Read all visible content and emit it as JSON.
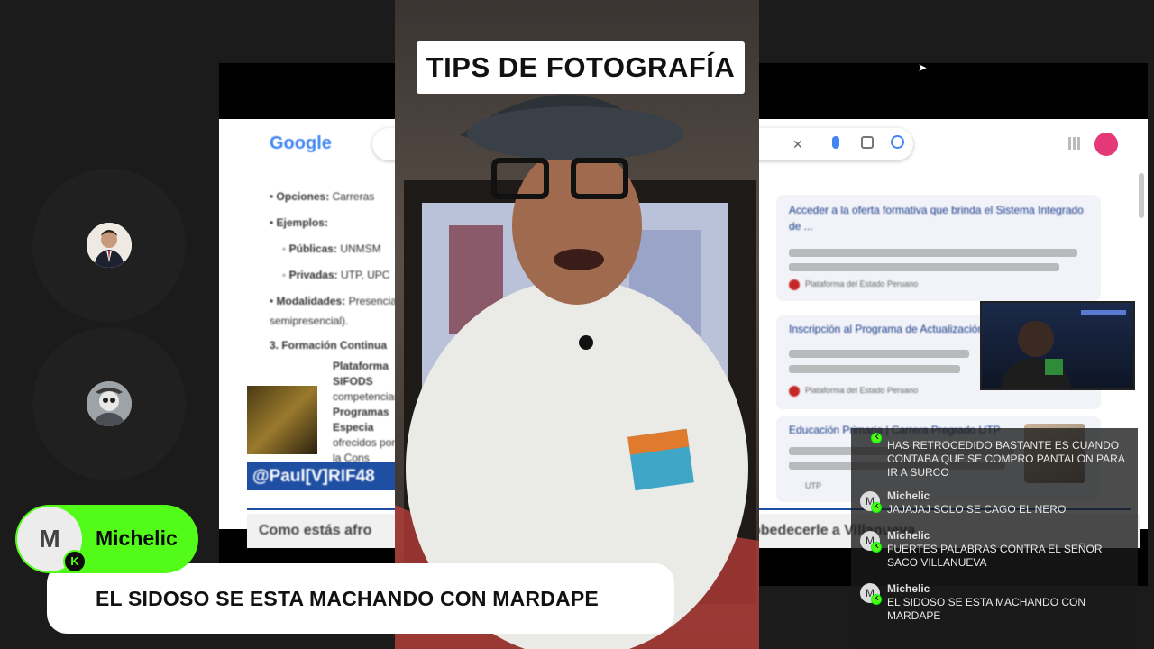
{
  "video": {
    "caption": "TIPS DE FOTOGRAFÍA"
  },
  "screen": {
    "google_logo": "Google",
    "list": [
      {
        "bullet": "•",
        "label": "Opciones:",
        "text": "Carreras"
      },
      {
        "bullet": "•",
        "label": "Ejemplos:",
        "text": ""
      },
      {
        "bullet": "◦",
        "label": "Públicas:",
        "text": "UNMSM"
      },
      {
        "bullet": "◦",
        "label": "Privadas:",
        "text": "UTP, UPC"
      },
      {
        "bullet": "•",
        "label": "Modalidades:",
        "text": "Presencial"
      },
      {
        "bullet": "",
        "label": "",
        "text": "semipresencial)."
      },
      {
        "bullet": "",
        "label": "3. Formación Continua",
        "text": ""
      },
      {
        "bullet": "",
        "label": "",
        "text": "Plataforma SIFODS"
      },
      {
        "bullet": "",
        "label": "",
        "text": "competencias."
      },
      {
        "bullet": "",
        "label": "",
        "text": "Programas Especia"
      },
      {
        "bullet": "",
        "label": "",
        "text": "ofrecidos por la Cons"
      }
    ],
    "tag": "@Paul[V]RIF48",
    "input_text": "Como estás afro",
    "input_tail": "obedecerle a Villanueva",
    "results": [
      {
        "title": "Acceder a la oferta formativa que brinda el Sistema Integrado de ...",
        "source": "Plataforma del Estado Peruano"
      },
      {
        "title": "Inscripción al Programa de Actualización",
        "source": "Plataforma del Estado Peruano"
      },
      {
        "title": "Educación Primaria | Carrera Pregrado UTP",
        "source": "UTP"
      }
    ]
  },
  "chat": {
    "messages": [
      {
        "avatar": "",
        "user": "",
        "text": "HAS RETROCEDIDO BASTANTE ES CUANDO CONTABA QUE SE COMPRO PANTALON PARA IR A SURCO"
      },
      {
        "avatar": "M",
        "user": "Michelic",
        "text": "JAJAJAJ SOLO SE CAGO EL NERO"
      },
      {
        "avatar": "M",
        "user": "Michelic",
        "text": "FUERTES PALABRAS CONTRA EL SEÑOR SACO VILLANUEVA"
      },
      {
        "avatar": "M",
        "user": "Michelic",
        "text": "EL SIDOSO SE ESTA MACHANDO CON MARDAPE"
      }
    ]
  },
  "featured": {
    "avatar_letter": "M",
    "badge": "K",
    "username": "Michelic",
    "message": "EL SIDOSO SE ESTA MACHANDO CON MARDAPE"
  },
  "colors": {
    "kick_green": "#53fc18",
    "background": "#1b1b1b"
  }
}
